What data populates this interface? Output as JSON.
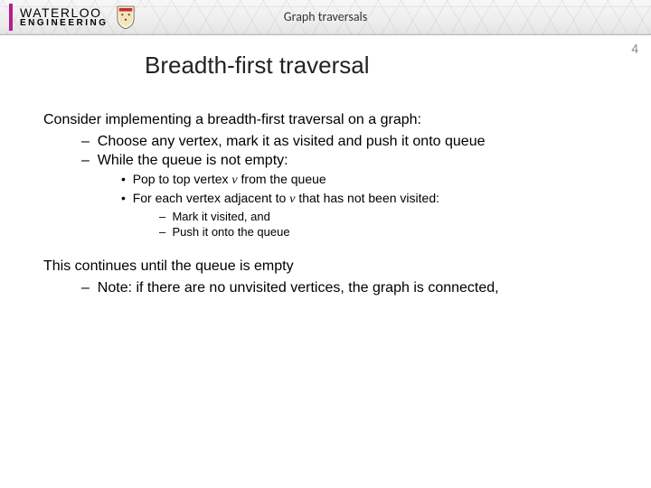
{
  "header": {
    "topic": "Graph traversals",
    "page_number": "4"
  },
  "logo": {
    "line1": "WATERLOO",
    "line2": "ENGINEERING"
  },
  "title": "Breadth-first traversal",
  "body": {
    "p1": "Consider implementing a breadth-first traversal on a graph:",
    "b1": "Choose any vertex, mark it as visited and push it onto queue",
    "b2": "While the queue is not empty:",
    "s1a": "Pop to top vertex ",
    "s1v": "v",
    "s1b": " from the queue",
    "s2a": "For each vertex adjacent to ",
    "s2v": "v",
    "s2b": " that has not been visited:",
    "t1": "Mark it visited, and",
    "t2": "Push it onto the queue",
    "p2": "This continues until the queue is empty",
    "n1": "Note:  if there are no unvisited vertices, the graph is connected,"
  }
}
